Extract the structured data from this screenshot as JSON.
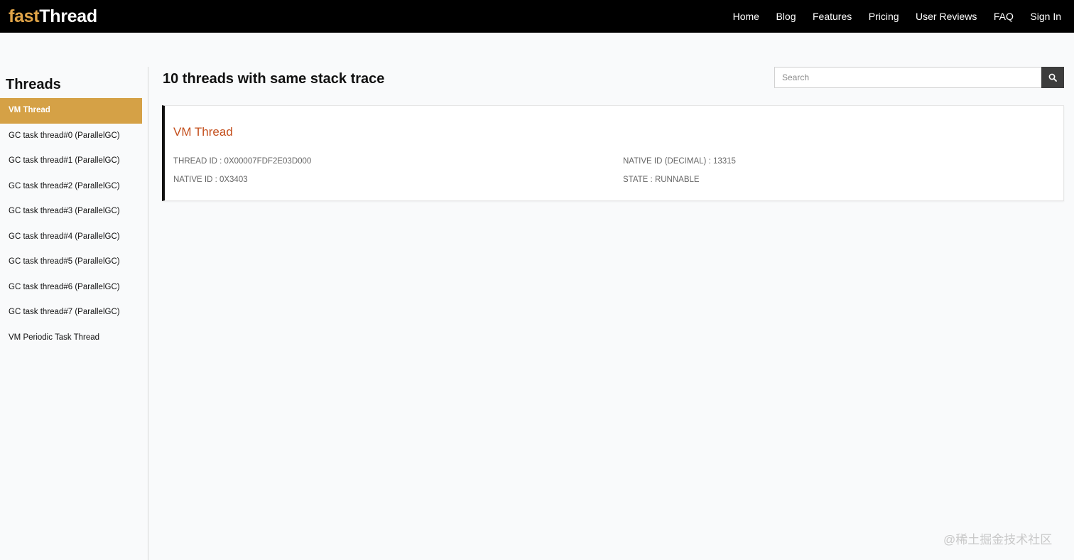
{
  "header": {
    "logo_part1": "fast",
    "logo_part2": "Thread",
    "nav": [
      "Home",
      "Blog",
      "Features",
      "Pricing",
      "User Reviews",
      "FAQ",
      "Sign In"
    ]
  },
  "sidebar": {
    "title": "Threads",
    "items": [
      "VM Thread",
      "GC task thread#0 (ParallelGC)",
      "GC task thread#1 (ParallelGC)",
      "GC task thread#2 (ParallelGC)",
      "GC task thread#3 (ParallelGC)",
      "GC task thread#4 (ParallelGC)",
      "GC task thread#5 (ParallelGC)",
      "GC task thread#6 (ParallelGC)",
      "GC task thread#7 (ParallelGC)",
      "VM Periodic Task Thread"
    ],
    "active_index": 0
  },
  "main": {
    "title": "10 threads with same stack trace",
    "search": {
      "placeholder": "Search",
      "value": ""
    },
    "card": {
      "name": "VM Thread",
      "thread_id": "THREAD ID : 0X00007FDF2E03D000",
      "native_id": "NATIVE ID : 0X3403",
      "native_id_decimal": "NATIVE ID (DECIMAL) : 13315",
      "state": "STATE : RUNNABLE"
    }
  },
  "watermark": "@稀土掘金技术社区",
  "colors": {
    "accent": "#d5a146",
    "logo_accent": "#e0a448",
    "card_title": "#c4501e",
    "header_bg": "#000000"
  },
  "icons": {
    "search_button": "search-icon"
  }
}
